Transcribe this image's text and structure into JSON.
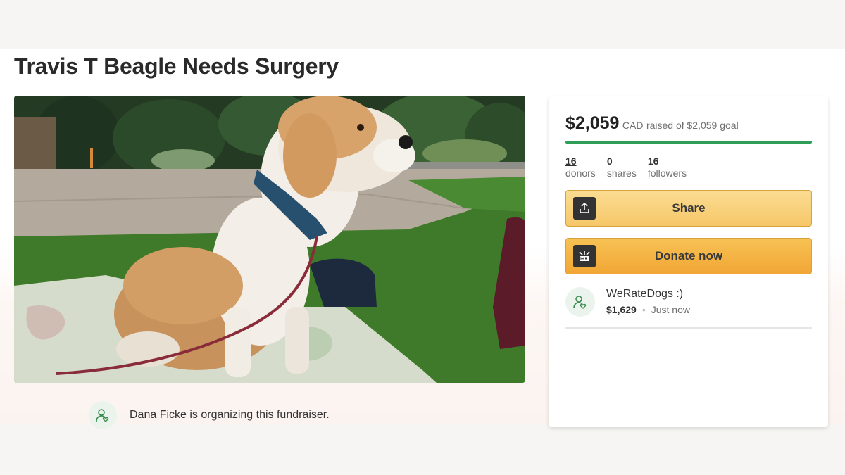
{
  "campaign": {
    "title": "Travis T Beagle Needs Surgery",
    "organizer_text": "Dana Ficke is organizing this fundraiser."
  },
  "photo": {
    "icon": "beagle-photo"
  },
  "progress": {
    "amount": "$2,059",
    "currency": "CAD",
    "raised_text": "raised of $2,059 goal",
    "fraction": 1.0,
    "color": "#2e9e56"
  },
  "stats": [
    {
      "value": "16",
      "label": "donors"
    },
    {
      "value": "0",
      "label": "shares"
    },
    {
      "value": "16",
      "label": "followers"
    }
  ],
  "buttons": {
    "share_label": "Share",
    "share_icon": "upload-icon",
    "donate_label": "Donate now",
    "donate_icon": "gofundme-logo-icon"
  },
  "recent_donation": {
    "name": "WeRateDogs :)",
    "amount": "$1,629",
    "time": "Just now"
  }
}
